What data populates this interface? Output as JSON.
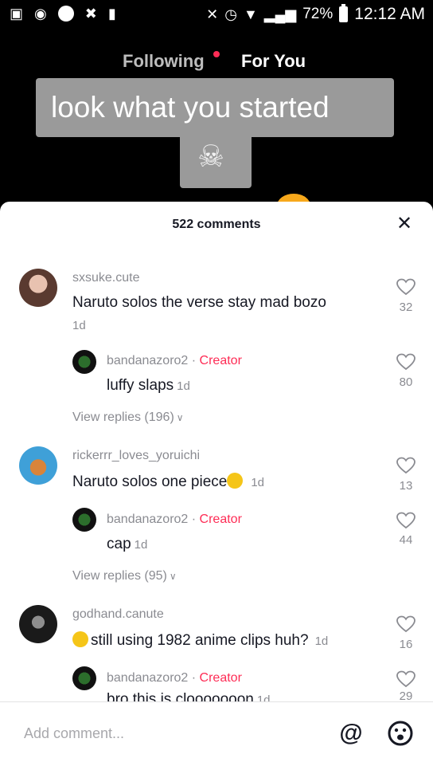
{
  "status_bar": {
    "battery": "72%",
    "time": "12:12 AM"
  },
  "top_nav": {
    "following": "Following",
    "for_you": "For You"
  },
  "video": {
    "caption": "look what you started"
  },
  "comments_sheet": {
    "title": "522 comments",
    "close_icon": "close-icon",
    "threads": [
      {
        "user": "sxsuke.cute",
        "text": "Naruto solos the verse stay mad bozo",
        "time": "1d",
        "likes": "32",
        "reply": {
          "user": "bandanazoro2",
          "badge": "Creator",
          "text": "luffy slaps",
          "time": "1d",
          "likes": "80"
        },
        "view_replies": "View replies (196)"
      },
      {
        "user": "rickerrr_loves_yoruichi",
        "text": "Naruto solos one piece",
        "time": "1d",
        "likes": "13",
        "reply": {
          "user": "bandanazoro2",
          "badge": "Creator",
          "text": "cap",
          "time": "1d",
          "likes": "44"
        },
        "view_replies": "View replies (95)"
      },
      {
        "user": "godhand.canute",
        "text": "still using 1982 anime clips huh?",
        "time": "1d",
        "likes": "16",
        "reply": {
          "user": "bandanazoro2",
          "badge": "Creator",
          "text": "bro this is clooooooon",
          "time": "1d",
          "likes": "29"
        }
      }
    ]
  },
  "input": {
    "placeholder": "Add comment...",
    "at_symbol": "@"
  },
  "colors": {
    "accent": "#fe2c55",
    "sheet_bg": "#ffffff",
    "muted_text": "#8a8b91"
  }
}
